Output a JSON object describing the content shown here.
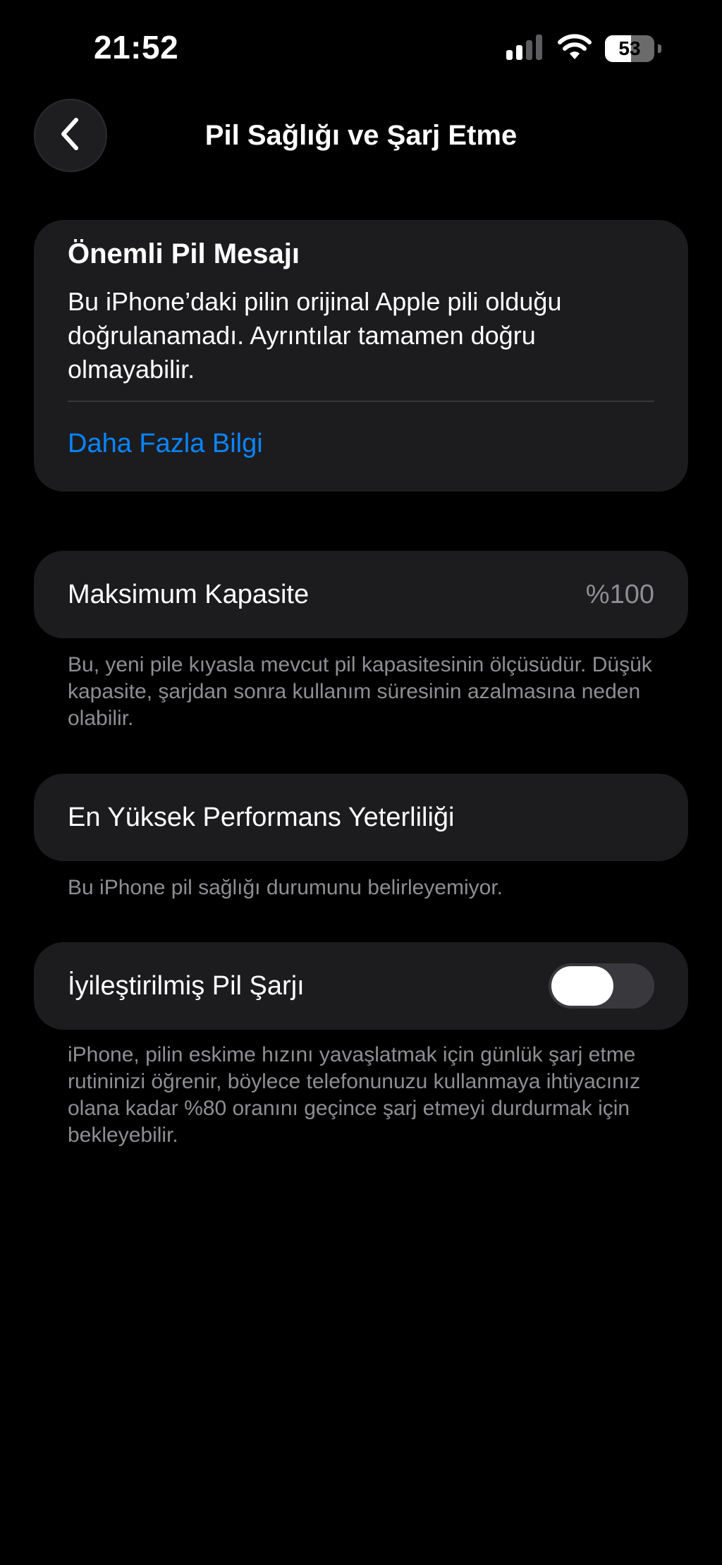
{
  "status_bar": {
    "time": "21:52",
    "battery_level": "53",
    "battery_fraction": 0.53,
    "icons": [
      "cellular-signal-icon",
      "wifi-icon",
      "battery-icon"
    ]
  },
  "nav": {
    "back_icon": "chevron-left-icon",
    "title": "Pil Sağlığı ve Şarj Etme"
  },
  "important_message": {
    "title": "Önemli Pil Mesajı",
    "body": "Bu iPhone’daki pilin orijinal Apple pili olduğu doğrulanamadı. Ayrıntılar tamamen doğru olmayabilir.",
    "link": "Daha Fazla Bilgi"
  },
  "max_capacity": {
    "label": "Maksimum Kapasite",
    "value": "%100",
    "footnote": "Bu, yeni pile kıyasla mevcut pil kapasitesinin ölçüsüdür. Düşük kapasite, şarjdan sonra kullanım süresinin azalmasına neden olabilir."
  },
  "peak_performance": {
    "label": "En Yüksek Performans Yeterliliği",
    "footnote": "Bu iPhone pil sağlığı durumunu belirleyemiyor."
  },
  "optimized_charging": {
    "label": "İyileştirilmiş Pil Şarjı",
    "toggle_on": false,
    "footnote": "iPhone, pilin eskime hızını yavaşlatmak için günlük şarj etme rutininizi öğrenir, böylece telefonunuzu kullanmaya ihtiyacınız olana kadar %80 oranını geçince şarj etmeyi durdurmak için bekleyebilir."
  },
  "colors": {
    "background": "#000000",
    "card": "#1c1c1e",
    "link": "#0a84ff",
    "secondary_text": "#8e8e93",
    "toggle_off": "#39393d"
  }
}
